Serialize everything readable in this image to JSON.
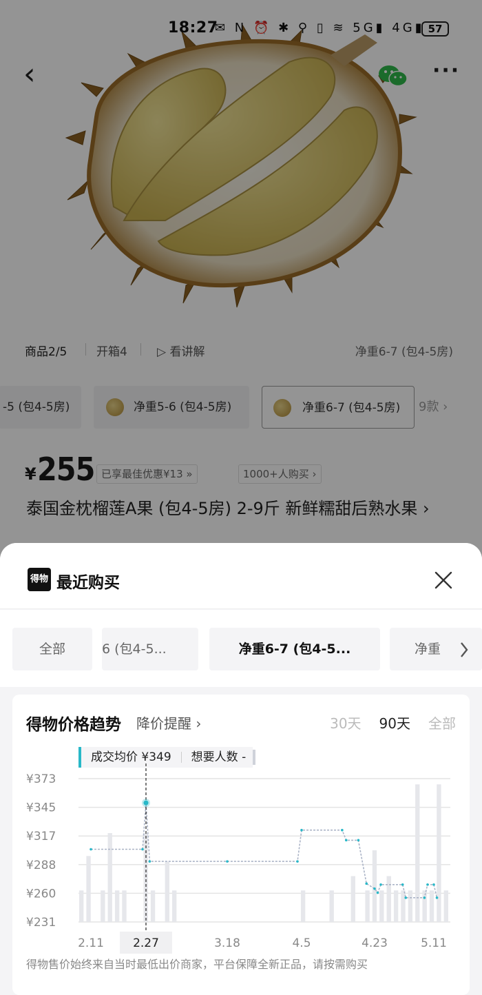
{
  "status_bar": {
    "time": "18:27",
    "icons_text": "✉ N ⏰ ✱ ⚲ ▯ ≋ 5G▮ 4G▮",
    "battery": "57"
  },
  "nav": {
    "back_glyph": "‹",
    "share_icon": "wechat-icon",
    "more_glyph": "···"
  },
  "media_tabs": {
    "items": [
      "商品2/5",
      "开箱4",
      "看讲解"
    ],
    "spec": "净重6-7 (包4-5房)"
  },
  "sku_options": {
    "items": [
      "-5 (包4-5房)",
      "净重5-6 (包4-5房)",
      "净重6-7 (包4-5房)"
    ],
    "more": "9款 ›"
  },
  "product": {
    "currency": "¥",
    "price": "255",
    "promo": "已享最佳优惠¥13 »",
    "buyers": "1000+人购买 ›",
    "title": "泰国金枕榴莲A果 (包4-5房) 2-9斤 新鲜糯甜后熟水果 ›"
  },
  "sheet": {
    "logo_text": "得物",
    "title": "最近购买",
    "filters": [
      "全部",
      "6 (包4-5...",
      "净重6-7 (包4-5...",
      "净重"
    ]
  },
  "price_trend": {
    "title": "得物价格趋势",
    "alert_link": "降价提醒 ›",
    "ranges": [
      "30天",
      "90天",
      "全部"
    ],
    "active_range": "90天",
    "tooltip": {
      "avg_label": "成交均价 ¥349",
      "wants_label": "想要人数 -"
    },
    "footnote": "得物售价始终来自当时最低出价商家，平台保障全新正品，请按需购买"
  },
  "colors": {
    "accent": "#28b8c8",
    "overlay": "rgba(0,0,0,0.42)",
    "bar": "#e6e7eb",
    "grid": "#e4e4e4",
    "line": "#aab3c6"
  },
  "chart_data": {
    "type": "line",
    "title": "得物价格趋势",
    "x_tick_labels": [
      "2.11",
      "2.27",
      "3.18",
      "4.5",
      "4.23",
      "5.11"
    ],
    "highlight_x": "2.27",
    "y_tick_labels": [
      "¥373",
      "¥345",
      "¥317",
      "¥288",
      "¥260",
      "¥231"
    ],
    "ylim": [
      231,
      373
    ],
    "series": [
      {
        "points": [
          [
            "2.11",
            303
          ],
          [
            "2.26",
            303
          ],
          [
            "2.27",
            349
          ],
          [
            "2.28",
            291
          ],
          [
            "3.18",
            291
          ],
          [
            "4.4",
            291
          ],
          [
            "4.5",
            322
          ],
          [
            "4.15",
            322
          ],
          [
            "4.16",
            312
          ],
          [
            "4.19",
            312
          ],
          [
            "4.21",
            269
          ],
          [
            "4.23",
            264
          ],
          [
            "4.24",
            260
          ],
          [
            "4.25",
            268
          ],
          [
            "5.1",
            268
          ],
          [
            "5.2",
            255
          ],
          [
            "5.8",
            255
          ],
          [
            "5.9",
            268
          ],
          [
            "5.11",
            268
          ],
          [
            "5.12",
            255
          ]
        ]
      }
    ],
    "volume_bars": [
      0.22,
      0.46,
      0.0,
      0.22,
      0.62,
      0.22,
      0.22,
      0.0,
      0.0,
      0.62,
      0.22,
      0.0,
      0.42,
      0.22,
      0.0,
      0.0,
      0.0,
      0.0,
      0.0,
      0.0,
      0.0,
      0.0,
      0.0,
      0.0,
      0.0,
      0.0,
      0.0,
      0.0,
      0.0,
      0.0,
      0.0,
      0.22,
      0.0,
      0.0,
      0.0,
      0.22,
      0.0,
      0.0,
      0.32,
      0.0,
      0.22,
      0.5,
      0.22,
      0.32,
      0.22,
      0.22,
      0.22,
      0.96,
      0.22,
      0.22,
      0.96,
      0.22
    ],
    "grid": true
  }
}
